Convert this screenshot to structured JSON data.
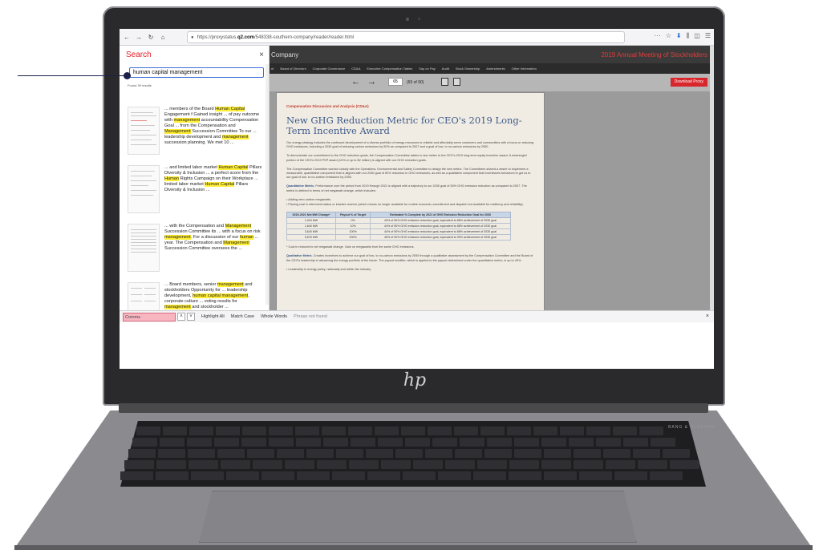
{
  "browser": {
    "url_prefix": "https://proxystatus.",
    "url_domain": "q2.com",
    "url_path": "/548338-southern-company/reader/reader.html",
    "right_icons": [
      "···",
      "☆",
      "⬇",
      "⫼",
      "◫",
      "☰"
    ]
  },
  "search_panel": {
    "title": "Search",
    "close": "×",
    "query": "human capital management",
    "results_count": "Found 39 results",
    "results": [
      {
        "parts": [
          {
            "t": "... members of the Board ",
            "h": false
          },
          {
            "t": "Human Capital",
            "h": true
          },
          {
            "t": " Engagement f Gained insight ... of pay outcome with ",
            "h": false
          },
          {
            "t": "management",
            "h": true
          },
          {
            "t": " accountability Compensation Goal ... from the Compensation and ",
            "h": false
          },
          {
            "t": "Management",
            "h": true
          },
          {
            "t": " Succession Committee To our ... leadership development and ",
            "h": false
          },
          {
            "t": "management",
            "h": true
          },
          {
            "t": " succession planning. We met 10 ...",
            "h": false
          }
        ]
      },
      {
        "parts": [
          {
            "t": "... and limited labor market ",
            "h": false
          },
          {
            "t": "Human Capital",
            "h": true
          },
          {
            "t": " Pillars Diversity & Inclusion ... a perfect score from the ",
            "h": false
          },
          {
            "t": "Human",
            "h": true
          },
          {
            "t": " Rights Campaign on their Workplace ... limited labor market ",
            "h": false
          },
          {
            "t": "Human Capital",
            "h": true
          },
          {
            "t": " Pillars Diversity & Inclusion ...",
            "h": false
          }
        ]
      },
      {
        "parts": [
          {
            "t": "... with the Compensation and ",
            "h": false
          },
          {
            "t": "Management",
            "h": true
          },
          {
            "t": " Succession Committee its ... with a focus on risk ",
            "h": false
          },
          {
            "t": "management",
            "h": true
          },
          {
            "t": ". For a discussion of our ",
            "h": false
          },
          {
            "t": "human",
            "h": true
          },
          {
            "t": " ... year. The Compensation and ",
            "h": false
          },
          {
            "t": "Management",
            "h": true
          },
          {
            "t": " Succession Committee oversees the ...",
            "h": false
          }
        ]
      },
      {
        "parts": [
          {
            "t": "... Board members, senior ",
            "h": false
          },
          {
            "t": "management",
            "h": true
          },
          {
            "t": " and stockholders Opportunity for ... leadership development, ",
            "h": false
          },
          {
            "t": "human capital management",
            "h": true
          },
          {
            "t": ", corporate culture ... voting results for ",
            "h": false
          },
          {
            "t": "management",
            "h": true
          },
          {
            "t": " and stockholder ...",
            "h": false
          }
        ]
      }
    ]
  },
  "viewer": {
    "company": "Company",
    "meeting": "2019 Annual Meeting of Stockholders",
    "nav": [
      "nt",
      "Board of Directors",
      "Corporate Governance",
      "CD&A",
      "Executive Compensation Tables",
      "Say on Pay",
      "Audit",
      "Stock Ownership",
      "Amendments",
      "Other Information"
    ],
    "page_number": "65",
    "page_count": "(65 of 90)",
    "download_label": "Download Proxy",
    "doc": {
      "kicker": "Compensation Discussion and Analysis (CD&A)",
      "title": "New GHG Reduction Metric for CEO's 2019 Long-Term Incentive Award",
      "para1": "Our energy strategy includes the continued development of a diverse portfolio of energy resources to reliable and affordably serve customers and communities with a focus on reducing GHG emissions, including a 2030 goal of reducing carbon emissions by 50% as compared to 2007 and a goal of low- to no-carbon emissions by 2050.",
      "para2": "To demonstrate our commitment to the GHG reduction goals, the Compensation Committee added a new metric to the CEO's 2019 long-term equity incentive award. A meaningful portion of the CEO's 2019 PSP award (10% or up to $2 million) is aligned with our GHG reduction goals.",
      "para3": "The Compensation Committee worked closely with the Operations, Environmental and Safety Committee to design the new metric. The Committees shared a desire to implement a measurable, quantitative component that is aligned with our 2030 goal of 50% reduction in GHG emissions, as well as a qualitative component that incentivizes behaviors to get us to our goal of low- to no-carbon emissions by 2050.",
      "para4_lead": "Quantitative Metric.",
      "para4": " Performance over the period from 2019 through 2021 is aligned with a trajectory to our 2030 goal of 50% GHG emission reduction as compared to 2007. The metric is defined in terms of net megawatt change, which includes:",
      "bullet1": "Adding zero-carbon megawatts.",
      "bullet2": "Placing coal in retirement status or inactive reserve (which means no longer available for routine economic commitment and dispatch but available for resiliency and reliability).",
      "table_headers": [
        "2019-2021 Net MW Change*",
        "Payout % of Target",
        "Estimated % Complete by 2021 of GHG Emission Reduction Goal for 2030"
      ],
      "table_rows": [
        [
          "1,024 MW",
          "0%",
          "43% of 50% GHG emission reduction goal, equivalent to 86% achievement of 2030 goal"
        ],
        [
          "1,640 MW",
          "10%",
          "44% of 50% GHG emission reduction goal, equivalent to 88% achievement of 2030 goal"
        ],
        [
          "3,640 MW",
          "100%",
          "44% of 50% GHG emission reduction goal, equivalent to 88% achievement of 2030 goal"
        ],
        [
          "5,576 MW",
          "200%",
          "45% of 50% GHG emission reduction goal, equivalent to 90% achievement of 2030 goal"
        ]
      ],
      "footnote": "* Coal in reduced to net megawatt change. Gain on megawatts from the same GHG emissions.",
      "para5_lead": "Qualitative Metric.",
      "para5": " Creates incentives to achieve our goal of low- to no-carbon emissions by 2050 through a qualitative assessment by the Compensation Committee and the Board of the CEO's leadership in advancing the energy portfolio of the future. The payout modifier, which is applied to the payout determined under the quantitative metric, is up to 40%.",
      "bullet3": "Leadership in energy policy, nationally and within the industry"
    }
  },
  "find_bar": {
    "input_value": "Comms",
    "highlight_all": "Highlight All",
    "match_case": "Match Case",
    "whole_words": "Whole Words",
    "status": "Phrase not found",
    "close": "×"
  },
  "device": {
    "logo": "hp",
    "brand": "BANG & OLUFSEN"
  },
  "colors": {
    "search_title": "#e01b24",
    "highlight": "#ffee33",
    "download_button": "#d8262d",
    "callout": "#1b1f4a"
  }
}
